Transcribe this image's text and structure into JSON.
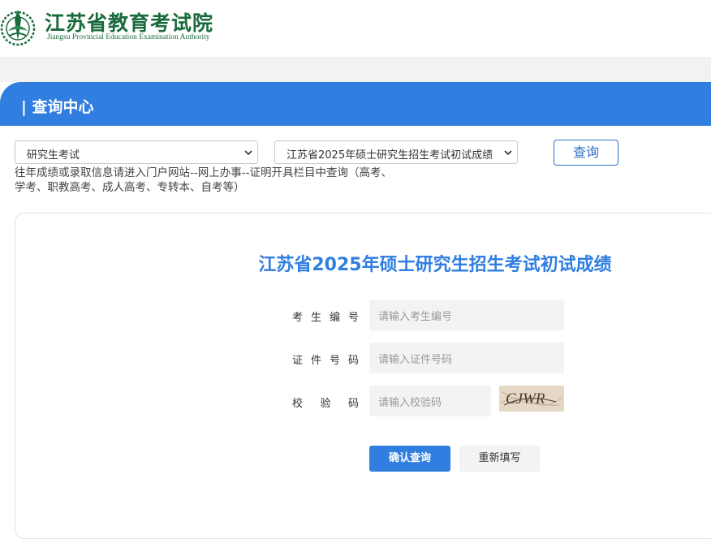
{
  "header": {
    "logo_cn": "江苏省教育考试院",
    "logo_en": "Jiangsu Provincial Education Examination Authority"
  },
  "section": {
    "title": "| 查询中心"
  },
  "filters": {
    "exam_type": "研究生考试",
    "exam_item": "江苏省2025年硕士研究生招生考试初试成绩",
    "query_button": "查询"
  },
  "notice": {
    "line1": "往年成绩或录取信息请进入门户网站--网上办事--证明开具栏目中查询（高考、",
    "line2": "学考、职教高考、成人高考、专转本、自考等）"
  },
  "form": {
    "title": "江苏省2025年硕士研究生招生考试初试成绩",
    "fields": [
      {
        "label": "考生编号",
        "placeholder": "请输入考生编号"
      },
      {
        "label": "证件号码",
        "placeholder": "请输入证件号码"
      },
      {
        "label": "校验码",
        "placeholder": "请输入校验码"
      }
    ],
    "captcha_text": "CJWR",
    "submit_label": "确认查询",
    "reset_label": "重新填写"
  },
  "colors": {
    "accent": "#2f7ee0",
    "brand_green": "#1a6b3c"
  }
}
